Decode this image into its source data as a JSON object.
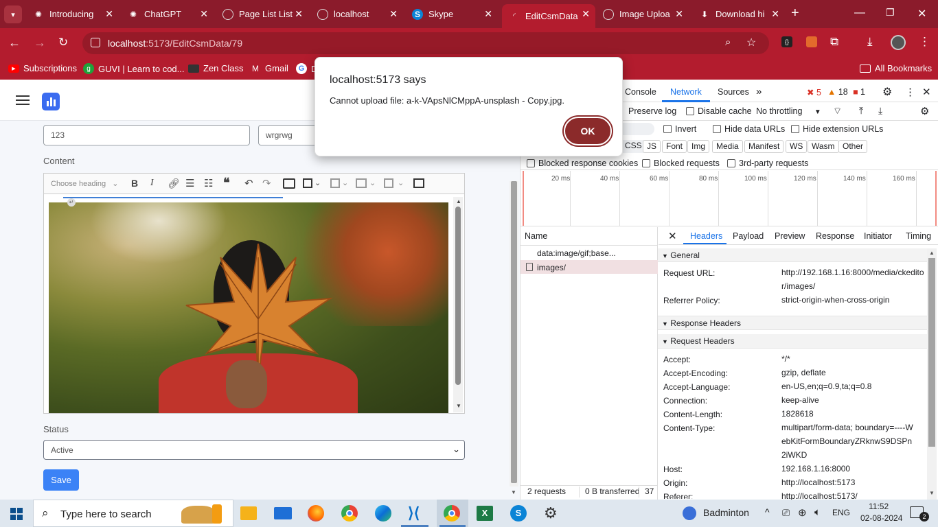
{
  "tabs": [
    {
      "title": "Introducing",
      "icon": "openai-icon"
    },
    {
      "title": "ChatGPT",
      "icon": "chatgpt-icon"
    },
    {
      "title": "Page List List",
      "icon": "globe-icon"
    },
    {
      "title": "localhost",
      "icon": "globe-icon"
    },
    {
      "title": "Skype",
      "icon": "skype-icon"
    },
    {
      "title": "EditCsmData",
      "icon": "loading-icon"
    },
    {
      "title": "Image Uploa",
      "icon": "globe-icon"
    },
    {
      "title": "Download hi",
      "icon": "download-icon"
    }
  ],
  "address": {
    "host": "localhost",
    "path": ":5173/EditCsmData/79"
  },
  "bookmarks": [
    {
      "label": "Subscriptions",
      "icon": "youtube-icon"
    },
    {
      "label": "GUVI | Learn to cod...",
      "icon": "guvi-icon"
    },
    {
      "label": "Zen Class",
      "icon": "zen-icon"
    },
    {
      "label": "Gmail",
      "icon": "gmail-icon"
    },
    {
      "label": "D",
      "icon": "google-icon"
    }
  ],
  "all_bookmarks": "All Bookmarks",
  "form": {
    "field1": "123",
    "field2": "wrgrwg",
    "content_label": "Content",
    "heading_select": "Choose heading",
    "status_label": "Status",
    "status_value": "Active",
    "save": "Save"
  },
  "dialog": {
    "title": "localhost:5173 says",
    "message": "Cannot upload file: a-k-VApsNlCMppA-unsplash - Copy.jpg.",
    "ok": "OK"
  },
  "devtools": {
    "tabs": [
      "Console",
      "Network",
      "Sources"
    ],
    "errors": "5",
    "warnings": "18",
    "info": "1",
    "preserve_log": "Preserve log",
    "disable_cache": "Disable cache",
    "throttling": "No throttling",
    "invert": "Invert",
    "hide_data_urls": "Hide data URLs",
    "hide_ext_urls": "Hide extension URLs",
    "filters": [
      "CSS",
      "JS",
      "Font",
      "Img",
      "Media",
      "Manifest",
      "WS",
      "Wasm",
      "Other"
    ],
    "blocked_cookies": "Blocked response cookies",
    "blocked_requests": "Blocked requests",
    "third_party": "3rd-party requests",
    "timeline": [
      "20 ms",
      "40 ms",
      "60 ms",
      "80 ms",
      "100 ms",
      "120 ms",
      "140 ms",
      "160 ms"
    ],
    "name_header": "Name",
    "requests": [
      "data:image/gif;base...",
      "images/"
    ],
    "detail_tabs": [
      "Headers",
      "Payload",
      "Preview",
      "Response",
      "Initiator",
      "Timing"
    ],
    "general": "General",
    "response_headers": "Response Headers",
    "request_headers": "Request Headers",
    "request_url_k": "Request URL:",
    "request_url_v": "http://192.168.1.16:8000/media/ckeditor/images/",
    "referrer_k": "Referrer Policy:",
    "referrer_v": "strict-origin-when-cross-origin",
    "headers": [
      {
        "k": "Accept:",
        "v": "*/*"
      },
      {
        "k": "Accept-Encoding:",
        "v": "gzip, deflate"
      },
      {
        "k": "Accept-Language:",
        "v": "en-US,en;q=0.9,ta;q=0.8"
      },
      {
        "k": "Connection:",
        "v": "keep-alive"
      },
      {
        "k": "Content-Length:",
        "v": "1828618"
      },
      {
        "k": "Content-Type:",
        "v": "multipart/form-data; boundary=----WebKitFormBoundaryZRknwS9DSPn2iWKD"
      },
      {
        "k": "Host:",
        "v": "192.168.1.16:8000"
      },
      {
        "k": "Origin:",
        "v": "http://localhost:5173"
      },
      {
        "k": "Referer:",
        "v": "http://localhost:5173/"
      }
    ],
    "summary_requests": "2 requests",
    "summary_transferred": "0 B transferred",
    "summary_extra": "37"
  },
  "taskbar": {
    "search": "Type here to search",
    "weather": "Badminton",
    "lang": "ENG",
    "time": "11:52",
    "date": "02-08-2024",
    "notifications": "2"
  },
  "colors": {
    "chrome": "#b31c2e",
    "tabstrip": "#8b1b2b",
    "accent": "#1a73e8",
    "save": "#3b82f6",
    "ok": "#8b2a2a"
  }
}
